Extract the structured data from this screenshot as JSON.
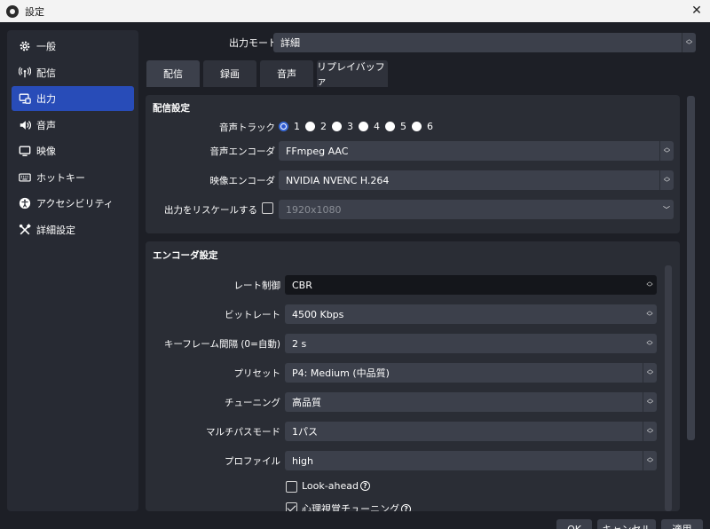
{
  "window": {
    "title": "設定",
    "close_glyph": "✕"
  },
  "sidebar": {
    "items": [
      {
        "label": "一般",
        "icon": "gear-icon",
        "active": false
      },
      {
        "label": "配信",
        "icon": "broadcast-icon",
        "active": false
      },
      {
        "label": "出力",
        "icon": "output-icon",
        "active": true
      },
      {
        "label": "音声",
        "icon": "speaker-icon",
        "active": false
      },
      {
        "label": "映像",
        "icon": "monitor-icon",
        "active": false
      },
      {
        "label": "ホットキー",
        "icon": "keyboard-icon",
        "active": false
      },
      {
        "label": "アクセシビリティ",
        "icon": "accessibility-icon",
        "active": false
      },
      {
        "label": "詳細設定",
        "icon": "tools-icon",
        "active": false
      }
    ]
  },
  "output_mode": {
    "label": "出力モード",
    "value": "詳細"
  },
  "tabs": [
    {
      "label": "配信",
      "active": true
    },
    {
      "label": "録画",
      "active": false
    },
    {
      "label": "音声",
      "active": false
    },
    {
      "label": "リプレイバッファ",
      "active": false
    }
  ],
  "stream_settings": {
    "title": "配信設定",
    "audio_track_label": "音声トラック",
    "audio_tracks": [
      "1",
      "2",
      "3",
      "4",
      "5",
      "6"
    ],
    "audio_track_selected": "1",
    "audio_encoder_label": "音声エンコーダ",
    "audio_encoder_value": "FFmpeg AAC",
    "video_encoder_label": "映像エンコーダ",
    "video_encoder_value": "NVIDIA NVENC H.264",
    "rescale_label": "出力をリスケールする",
    "rescale_checked": false,
    "rescale_value": "1920x1080"
  },
  "encoder_settings": {
    "title": "エンコーダ設定",
    "rate_control_label": "レート制御",
    "rate_control_value": "CBR",
    "bitrate_label": "ビットレート",
    "bitrate_value": "4500 Kbps",
    "keyframe_label": "キーフレーム間隔 (0=自動)",
    "keyframe_value": "2 s",
    "preset_label": "プリセット",
    "preset_value": "P4: Medium (中品質)",
    "tuning_label": "チューニング",
    "tuning_value": "高品質",
    "multipass_label": "マルチパスモード",
    "multipass_value": "1パス",
    "profile_label": "プロファイル",
    "profile_value": "high",
    "lookahead_label": "Look-ahead",
    "lookahead_checked": false,
    "psycho_label": "心理視覚チューニング",
    "psycho_checked": true
  },
  "footer": {
    "ok_label": "OK",
    "cancel_label": "キャンセル",
    "apply_label": "適用"
  },
  "colors": {
    "accent": "#284cb8",
    "background": "#1d1f26",
    "panel": "#2a2d35",
    "control": "#3c404b"
  }
}
